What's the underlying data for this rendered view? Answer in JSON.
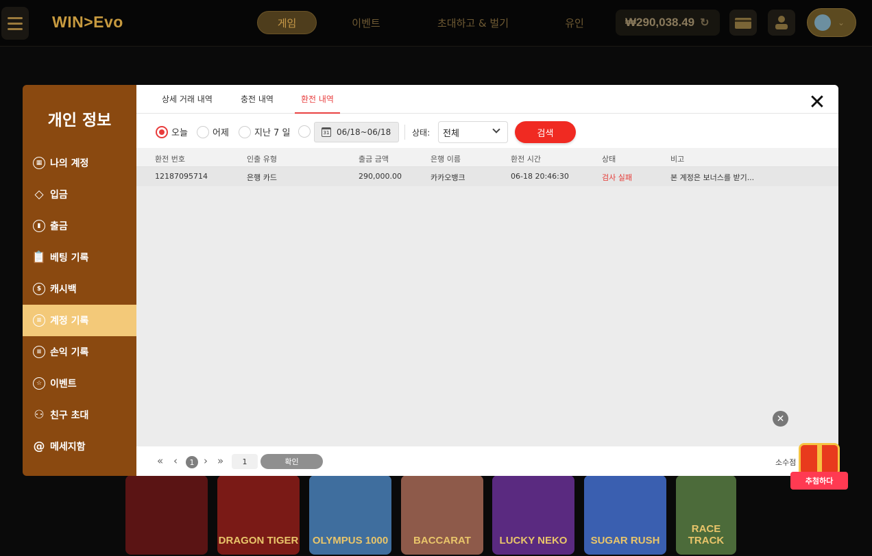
{
  "header": {
    "logo": "WIN>Evo",
    "nav": [
      "게임",
      "이벤트",
      "초대하고 & 벌기",
      "유인"
    ],
    "balance": "₩290,038.49"
  },
  "modal": {
    "sidebar": {
      "title": "개인 정보",
      "items": [
        {
          "label": "나의 계정",
          "icon": "account-icon"
        },
        {
          "label": "입금",
          "icon": "deposit-icon"
        },
        {
          "label": "출금",
          "icon": "withdraw-icon"
        },
        {
          "label": "베팅 기록",
          "icon": "clipboard-icon"
        },
        {
          "label": "캐시백",
          "icon": "moneybag-icon"
        },
        {
          "label": "계정 기록",
          "icon": "record-icon"
        },
        {
          "label": "손익 기록",
          "icon": "profit-icon"
        },
        {
          "label": "이벤트",
          "icon": "star-icon"
        },
        {
          "label": "친구 초대",
          "icon": "invite-icon"
        },
        {
          "label": "메세지함",
          "icon": "at-icon"
        }
      ],
      "active_index": 5
    },
    "tabs": [
      "상세 거래 내역",
      "충전 내역",
      "환전 내역"
    ],
    "active_tab": 2,
    "filter": {
      "radios": [
        "오늘",
        "어제",
        "지난 7 일"
      ],
      "selected_radio": 0,
      "date_range": "06/18~06/18",
      "calendar_day": "31",
      "status_label": "상태:",
      "status_value": "전체",
      "search_label": "검색"
    },
    "table": {
      "columns": [
        "환전 번호",
        "인출 유형",
        "출금 금액",
        "은행 이름",
        "환전 시간",
        "상태",
        "비고"
      ],
      "rows": [
        [
          "12187095714",
          "은행 카드",
          "290,000.00",
          "카카오뱅크",
          "06-18 20:46:30",
          "검사 실패",
          "본 계정은 보너스를 받기..."
        ]
      ]
    },
    "pager": {
      "current_page": "1",
      "page_input": "1",
      "confirm_label": "확인",
      "decimal_label": "소수점"
    }
  },
  "gift": {
    "label": "추첨하다"
  },
  "colors": {
    "sidebar": "#8a4910",
    "sidebar_active": "#f3c979",
    "accent_red": "#f02a22"
  },
  "background_thumbs": [
    "DRAGON TIGER",
    "OLYMPUS 1000",
    "BACCARAT",
    "LUCKY NEKO",
    "SUGAR RUSH",
    "RACE TRACK"
  ]
}
